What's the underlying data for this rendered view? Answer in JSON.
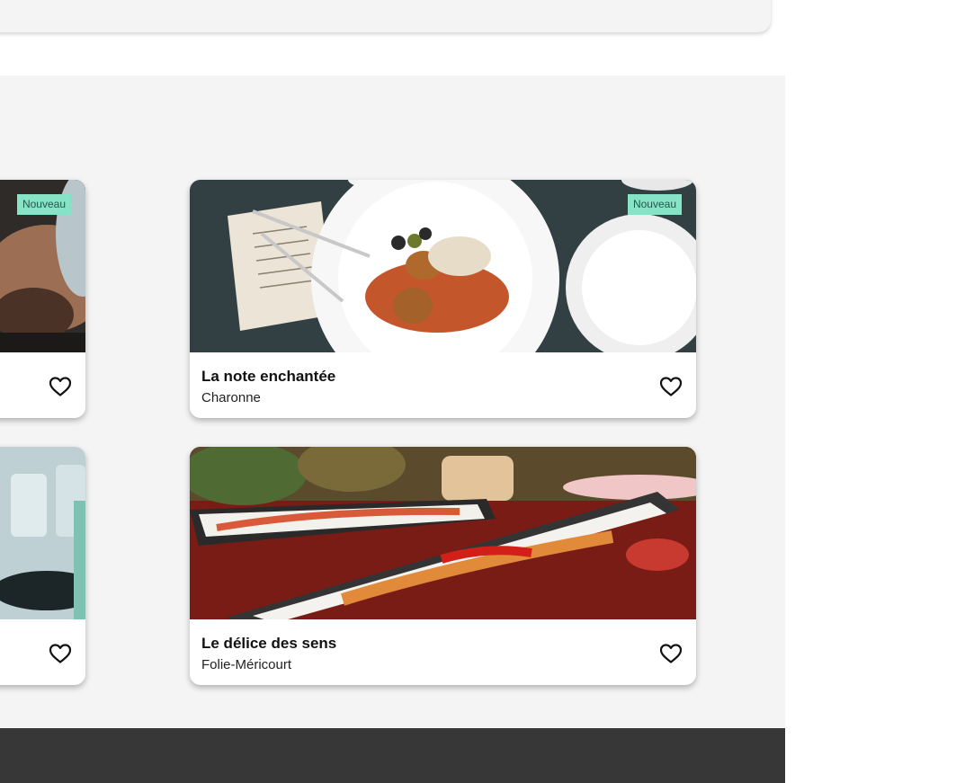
{
  "cards": [
    {
      "name": "",
      "district": "",
      "badge": "Nouveau",
      "favorite_icon": "heart-outline-icon"
    },
    {
      "name": "La note enchantée",
      "district": "Charonne",
      "badge": "Nouveau",
      "favorite_icon": "heart-outline-icon"
    },
    {
      "name": "",
      "district": "",
      "badge": "",
      "favorite_icon": "heart-outline-icon"
    },
    {
      "name": "Le délice des sens",
      "district": "Folie-Méricourt",
      "badge": "",
      "favorite_icon": "heart-outline-icon"
    }
  ],
  "colors": {
    "section_bg": "#f4f4f4",
    "footer_bg": "#373737",
    "badge_bg": "#86e3c5",
    "badge_text": "#23574a"
  }
}
